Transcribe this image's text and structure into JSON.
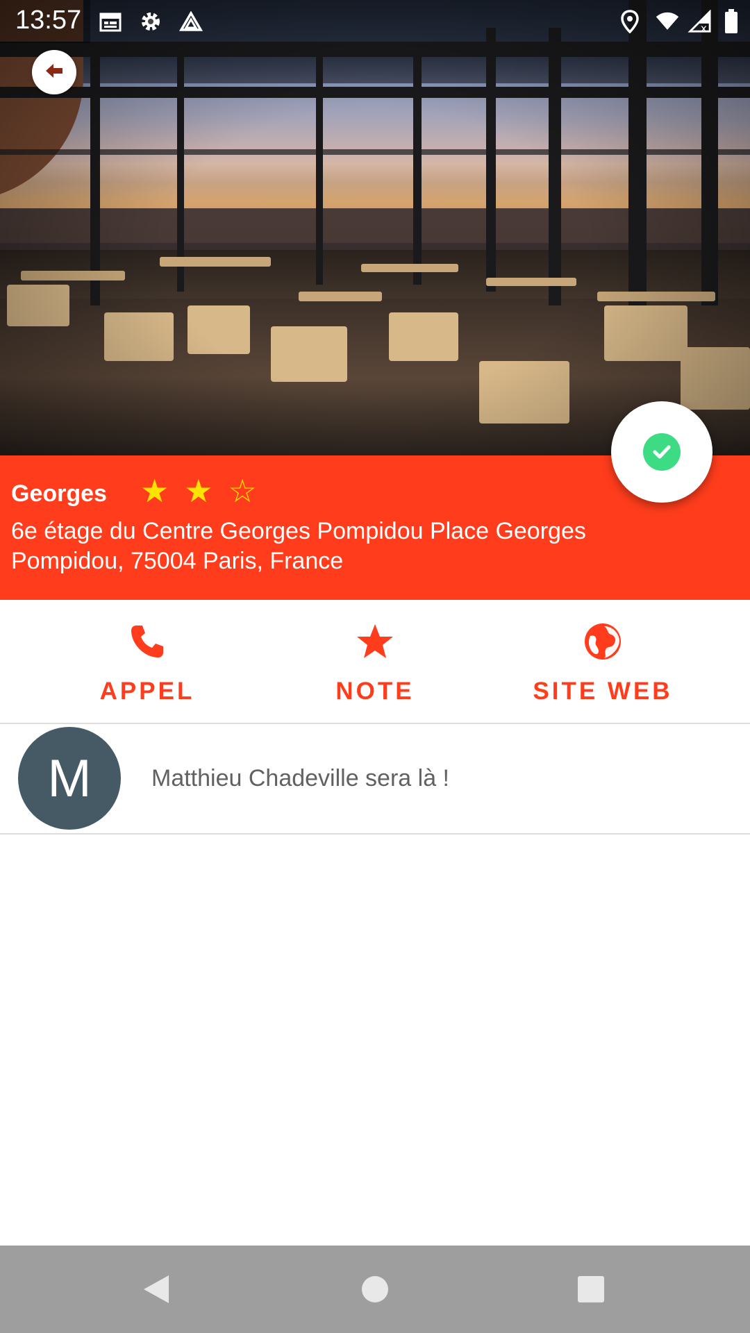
{
  "status_bar": {
    "time": "13:57",
    "left_icons": [
      "calendar-icon",
      "settings-icon",
      "drive-icon"
    ],
    "right_icons": [
      "location-icon",
      "wifi-icon",
      "signal-icon",
      "battery-icon"
    ]
  },
  "hero": {
    "image": "restaurant-interior-photo"
  },
  "place": {
    "name": "Georges",
    "rating": 2,
    "rating_max": 3,
    "stars": [
      "★",
      "★",
      "☆"
    ],
    "address": "6e étage du Centre Georges Pompidou Place Georges Pompidou, 75004 Paris, France"
  },
  "actions": [
    {
      "label": "APPEL",
      "icon": "phone-icon"
    },
    {
      "label": "NOTE",
      "icon": "star-icon"
    },
    {
      "label": "SITE WEB",
      "icon": "globe-icon"
    }
  ],
  "attendees": [
    {
      "initial": "M",
      "message": "Matthieu Chadeville sera là !"
    }
  ],
  "colors": {
    "accent": "#ff3d1c",
    "star": "#ffe300",
    "check": "#3ddc84",
    "avatar": "#455a64",
    "navbar": "#9e9e9e"
  }
}
